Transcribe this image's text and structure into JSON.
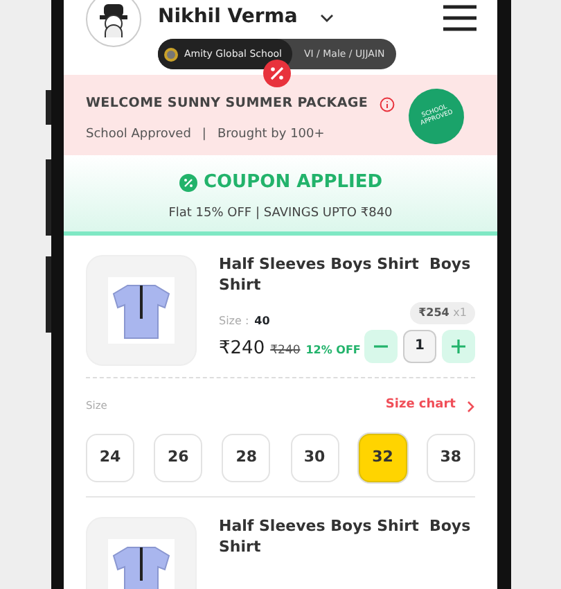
{
  "header": {
    "name": "Nikhil Verma",
    "school": "Amity Global School",
    "details": "VI / Male / UJJAIN"
  },
  "banner": {
    "title": "WELCOME SUNNY SUMMER PACKAGE",
    "subtitle_parts": [
      "School Approved",
      "Brought by 100+"
    ],
    "separator": "|",
    "stamp": "SCHOOL APPROVED"
  },
  "coupon": {
    "title": "COUPON APPLIED",
    "subtitle": "Flat 15% OFF | SAVINGS UPTO ₹840"
  },
  "items": [
    {
      "title": "Half Sleeves Boys Shirt  Boys Shirt",
      "size_label": "Size :",
      "size": "40",
      "price": "₹240",
      "mrp": "₹240",
      "discount": "12% OFF",
      "unit_price": "₹254",
      "multiplier": "x1",
      "quantity": "1",
      "size_picker": {
        "label": "Size",
        "chart_link": "Size chart",
        "sizes": [
          {
            "label": "24",
            "selected": false
          },
          {
            "label": "26",
            "selected": false
          },
          {
            "label": "28",
            "selected": false
          },
          {
            "label": "30",
            "selected": false
          },
          {
            "label": "32",
            "selected": true
          },
          {
            "label": "38",
            "selected": false
          }
        ]
      }
    },
    {
      "title": "Half Sleeves Boys Shirt  Boys Shirt"
    }
  ]
}
